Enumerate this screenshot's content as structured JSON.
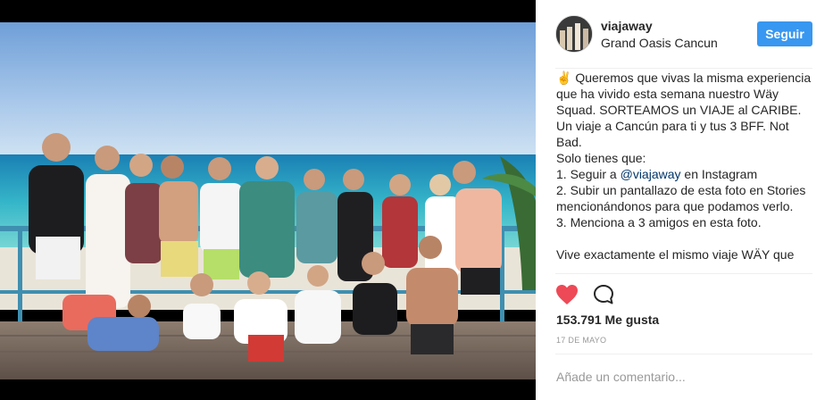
{
  "post": {
    "username": "viajaway",
    "location": "Grand Oasis Cancun",
    "follow_label": "Seguir",
    "caption_lead": "✌️ Queremos que vivas la misma experiencia que ha vivido esta semana nuestro Wäy Squad. SORTEAMOS un VIAJE al CARIBE. Un viaje a Cancún para ti y tus 3 BFF. Not Bad.\nSolo tienes que:\n1. Seguir a ",
    "caption_mention": "@viajaway",
    "caption_rest": " en Instagram\n2. Subir un pantallazo de esta foto en Stories mencionándonos para que podamos verlo.\n3. Menciona a 3 amigos en esta foto.\n\nVive exactamente el mismo viaje WÄY que",
    "likes": "153.791 Me gusta",
    "date": "17 DE MAYO",
    "comment_placeholder": "Añade un comentario..."
  },
  "icons": {
    "like": "heart-icon",
    "comment": "speech-bubble-icon"
  },
  "colors": {
    "follow_button": "#3897f0",
    "heart_liked": "#ed4956",
    "mention": "#003569",
    "text": "#262626",
    "muted": "#999999"
  }
}
